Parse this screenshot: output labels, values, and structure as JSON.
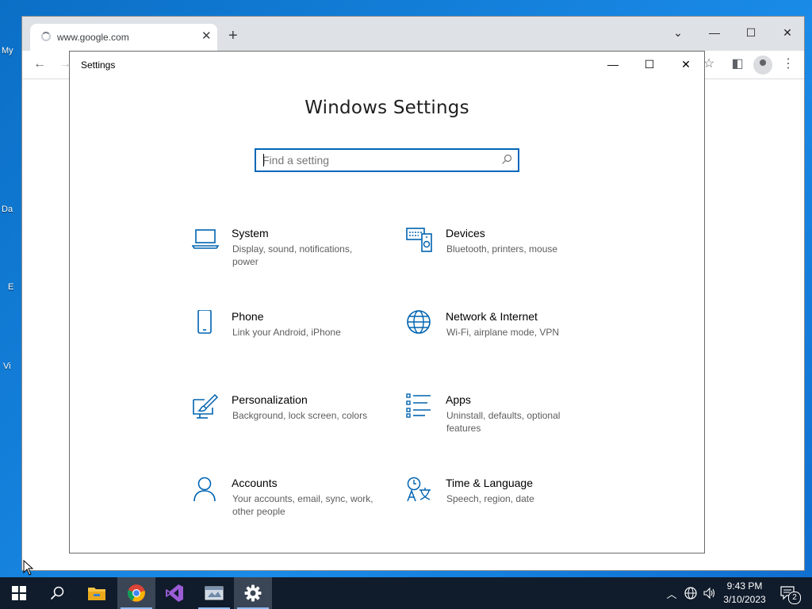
{
  "desktop": {
    "labels": [
      "My",
      "Da",
      "E",
      "Vi"
    ]
  },
  "chrome": {
    "tab_title": "www.google.com",
    "tab_close": "✕",
    "new_tab": "+",
    "controls": {
      "dropdown": "⌄",
      "minimize": "—",
      "maximize": "☐",
      "close": "✕"
    },
    "toolbar": {
      "back": "←",
      "forward": "→",
      "star": "☆",
      "sidepanel": "◧",
      "menu": "⋮"
    }
  },
  "settings": {
    "window_title": "Settings",
    "heading": "Windows Settings",
    "search_placeholder": "Find a setting",
    "categories": [
      {
        "name": "System",
        "desc": "Display, sound, notifications, power",
        "icon": "laptop-icon"
      },
      {
        "name": "Devices",
        "desc": "Bluetooth, printers, mouse",
        "icon": "devices-icon"
      },
      {
        "name": "Phone",
        "desc": "Link your Android, iPhone",
        "icon": "phone-icon"
      },
      {
        "name": "Network & Internet",
        "desc": "Wi-Fi, airplane mode, VPN",
        "icon": "globe-icon"
      },
      {
        "name": "Personalization",
        "desc": "Background, lock screen, colors",
        "icon": "paintbrush-icon"
      },
      {
        "name": "Apps",
        "desc": "Uninstall, defaults, optional features",
        "icon": "apps-list-icon"
      },
      {
        "name": "Accounts",
        "desc": "Your accounts, email, sync, work, other people",
        "icon": "person-icon"
      },
      {
        "name": "Time & Language",
        "desc": "Speech, region, date",
        "icon": "time-language-icon"
      }
    ]
  },
  "taskbar": {
    "apps": [
      "start",
      "search",
      "file-explorer",
      "chrome",
      "visual-studio",
      "app",
      "settings"
    ],
    "time": "9:43 PM",
    "date": "3/10/2023",
    "notification_count": "2"
  },
  "colors": {
    "accent": "#0067b8",
    "taskbar": "#101b2b",
    "icon_blue": "#0063b1"
  }
}
